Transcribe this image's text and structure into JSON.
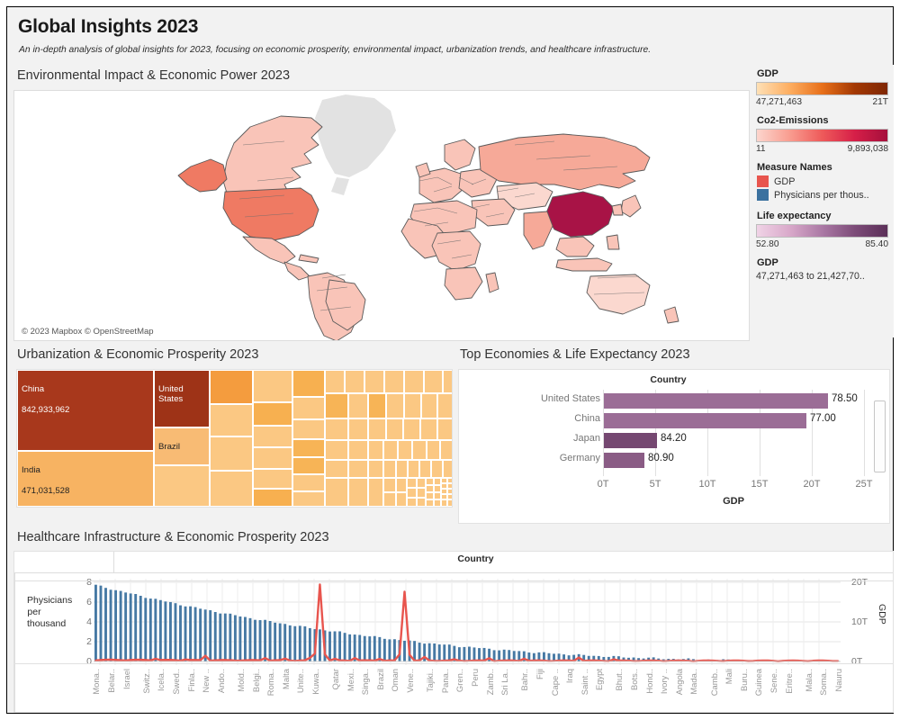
{
  "header": {
    "title": "Global Insights 2023",
    "subtitle": "An in-depth analysis of global insights for 2023, focusing on economic prosperity, environmental impact, urbanization trends, and healthcare infrastructure."
  },
  "map_panel": {
    "title": "Environmental Impact & Economic Power 2023",
    "attribution": "© 2023 Mapbox © OpenStreetMap"
  },
  "legend": {
    "gdp": {
      "title": "GDP",
      "min": "47,271,463",
      "max": "21T",
      "ramp_start": "#fdd0a2",
      "ramp_end": "#8c2d04"
    },
    "co2": {
      "title": "Co2-Emissions",
      "min": "11",
      "max": "9,893,038",
      "ramp_start": "#fcc5bd",
      "ramp_end": "#b10f3c"
    },
    "measure_names": {
      "title": "Measure Names",
      "items": [
        {
          "label": "GDP",
          "color": "#e8554e"
        },
        {
          "label": "Physicians per thous..",
          "color": "#3b719f"
        }
      ]
    },
    "life_expectancy": {
      "title": "Life expectancy",
      "min": "52.80",
      "max": "85.40",
      "ramp_start": "#eecfe4",
      "ramp_end": "#6b3960"
    },
    "gdp_range": {
      "title": "GDP",
      "value": "47,271,463 to 21,427,70.."
    }
  },
  "treemap_panel": {
    "title": "Urbanization & Economic Prosperity 2023",
    "labeled_cells": [
      {
        "name": "China",
        "value": "842,933,962"
      },
      {
        "name": "United States",
        "value": ""
      },
      {
        "name": "Brazil",
        "value": ""
      },
      {
        "name": "India",
        "value": "471,031,528"
      }
    ]
  },
  "bar_panel": {
    "title": "Top Economies & Life Expectancy 2023",
    "column_header": "Country",
    "x_axis_label": "GDP",
    "x_ticks": [
      "0T",
      "5T",
      "10T",
      "15T",
      "20T",
      "25T"
    ]
  },
  "combo_panel": {
    "title": "Healthcare Infrastructure & Economic Prosperity 2023",
    "column_header": "Country",
    "y_left_label": "Physicians per\nthousand",
    "y_left_ticks": [
      "8",
      "6",
      "4",
      "2",
      "0"
    ],
    "y_right_label": "GDP",
    "y_right_ticks": [
      "20T",
      "10T",
      "0T"
    ]
  },
  "chart_data": [
    {
      "type": "bar",
      "name": "top-economies-life-expectancy",
      "title": "Top Economies & Life Expectancy 2023",
      "orientation": "horizontal",
      "categories": [
        "United States",
        "China",
        "Japan",
        "Germany"
      ],
      "xlabel": "GDP",
      "ylabel": "Country",
      "xlim": [
        0,
        27
      ],
      "x_tick_values": [
        0,
        5,
        10,
        15,
        20,
        25
      ],
      "x_tick_labels": [
        "0T",
        "5T",
        "10T",
        "15T",
        "20T",
        "25T"
      ],
      "series": [
        {
          "name": "GDP (trillions USD)",
          "values": [
            21.43,
            19.37,
            5.08,
            3.86
          ]
        },
        {
          "name": "Life expectancy",
          "values": [
            78.5,
            77.0,
            84.2,
            80.9
          ]
        }
      ],
      "data_labels": [
        "78.50",
        "77.00",
        "84.20",
        "80.90"
      ],
      "color_field": "Life expectancy",
      "bar_colors": [
        "#9b6d96",
        "#9b6d96",
        "#754871",
        "#8a5c85"
      ],
      "legend": "none",
      "grid": true
    },
    {
      "type": "treemap",
      "name": "urbanization-economic-prosperity",
      "title": "Urbanization & Economic Prosperity 2023",
      "size_field": "Urban population",
      "color_field": "GDP",
      "labeled_items": [
        {
          "label": "China",
          "size": 842933962,
          "color": "#a8381c"
        },
        {
          "label": "India",
          "size": 471031528,
          "color": "#f7b362"
        },
        {
          "label": "United States",
          "size": 0,
          "color": "#9e3317"
        },
        {
          "label": "Brazil",
          "size": 0,
          "color": "#f8bb74"
        }
      ],
      "color_scale": [
        "#fcd9a5",
        "#8c2d04"
      ]
    },
    {
      "type": "line",
      "name": "healthcare-infrastructure-economic-prosperity",
      "title": "Healthcare Infrastructure & Economic Prosperity 2023",
      "xlabel": "Country",
      "ylabel": "Physicians per thousand",
      "y2label": "GDP",
      "ylim": [
        0,
        8.8
      ],
      "y_tick_values": [
        0,
        2,
        4,
        6,
        8
      ],
      "y2lim": [
        0,
        22
      ],
      "y2_tick_values": [
        0,
        10,
        20
      ],
      "y2_tick_labels": [
        "0T",
        "10T",
        "20T"
      ],
      "categories": [
        "Mona..",
        "Belar..",
        "Israel",
        "Switz..",
        "Icela..",
        "Swed..",
        "Finla..",
        "New ..",
        "Ando..",
        "Mold..",
        "Belgi..",
        "Roma..",
        "Malta",
        "Unite..",
        "Kuwa..",
        "Qatar",
        "Mexi..",
        "Singa..",
        "Brazil",
        "Oman",
        "Vene..",
        "Tajiki..",
        "Pana..",
        "Gren..",
        "Peru",
        "Zamb..",
        "Sri La..",
        "Bahr..",
        "Fiji",
        "Cape ..",
        "Iraq",
        "Saint ..",
        "Egypt",
        "Bhut..",
        "Bots..",
        "Hond..",
        "Ivory ..",
        "Angola",
        "Mada..",
        "Camb..",
        "Mali",
        "Buru..",
        "Guinea",
        "Sene..",
        "Eritre..",
        "Mala..",
        "Soma..",
        "Nauru"
      ],
      "series": [
        {
          "name": "Physicians per thousand",
          "color": "#3b719f",
          "mark": "bar"
        },
        {
          "name": "GDP",
          "color": "#e8554e",
          "mark": "line"
        }
      ],
      "note": "Physicians bars descend from ~8.4 to ~0.02; GDP line is flat near 0 with tall spikes at United States (~21T) and China (~19T)."
    }
  ]
}
